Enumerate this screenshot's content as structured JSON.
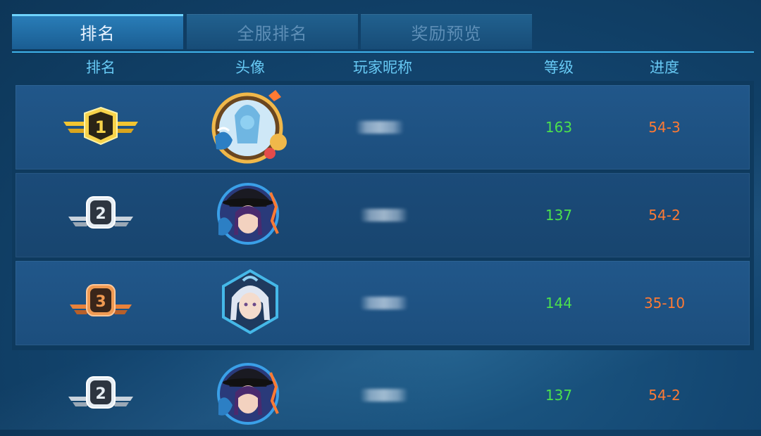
{
  "tabs": [
    {
      "label": "排名",
      "active": true
    },
    {
      "label": "全服排名",
      "active": false
    },
    {
      "label": "奖励预览",
      "active": false
    }
  ],
  "columns": {
    "rank": "排名",
    "avatar": "头像",
    "nickname": "玩家昵称",
    "level": "等级",
    "progress": "进度"
  },
  "rows": [
    {
      "rank": "1",
      "badge": "gold-medal-icon",
      "avatar": "ice-dragon-avatar",
      "level": "163",
      "progress": "54-3"
    },
    {
      "rank": "2",
      "badge": "silver-medal-icon",
      "avatar": "witch-girl-avatar",
      "level": "137",
      "progress": "54-2"
    },
    {
      "rank": "3",
      "badge": "bronze-medal-icon",
      "avatar": "white-hair-girl-avatar",
      "level": "144",
      "progress": "35-10"
    },
    {
      "rank": "2",
      "badge": "silver-medal-icon",
      "avatar": "witch-girl-avatar",
      "level": "137",
      "progress": "54-2"
    }
  ],
  "colors": {
    "level": "#4ce04c",
    "progress": "#ff7a33",
    "header": "#67c9f4",
    "tab_accent": "#6fd4ff"
  }
}
